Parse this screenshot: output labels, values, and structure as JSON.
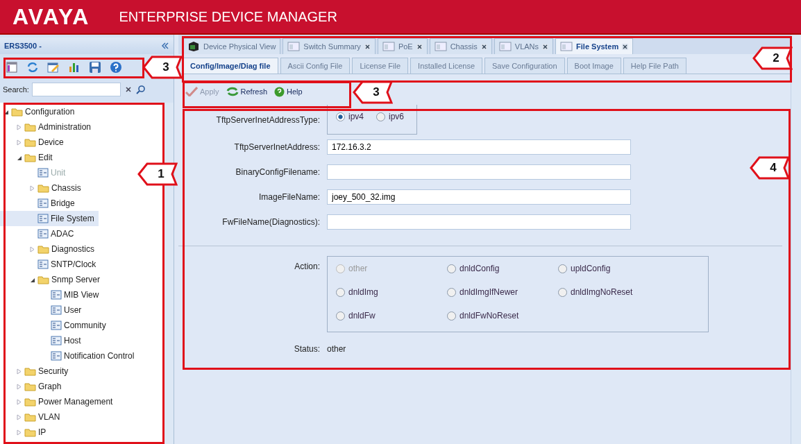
{
  "header": {
    "logo": "AVAYA",
    "title": "ENTERPRISE DEVICE MANAGER"
  },
  "sidebar": {
    "title": "ERS3500 -",
    "search": {
      "label": "Search:"
    },
    "tree": [
      {
        "label": "Configuration",
        "kind": "folder",
        "expanded": true,
        "selected": false,
        "disabled": false,
        "children": [
          {
            "label": "Administration",
            "kind": "folder",
            "expanded": false,
            "selected": false,
            "disabled": false
          },
          {
            "label": "Device",
            "kind": "folder",
            "expanded": false,
            "selected": false,
            "disabled": false
          },
          {
            "label": "Edit",
            "kind": "folder",
            "expanded": true,
            "selected": false,
            "disabled": false,
            "children": [
              {
                "label": "Unit",
                "kind": "leaf",
                "selected": false,
                "disabled": true
              },
              {
                "label": "Chassis",
                "kind": "folder",
                "expanded": false,
                "selected": false,
                "disabled": false
              },
              {
                "label": "Bridge",
                "kind": "leaf",
                "selected": false,
                "disabled": false
              },
              {
                "label": "File System",
                "kind": "leaf",
                "selected": true,
                "disabled": false
              },
              {
                "label": "ADAC",
                "kind": "leaf",
                "selected": false,
                "disabled": false
              },
              {
                "label": "Diagnostics",
                "kind": "folder",
                "expanded": false,
                "selected": false,
                "disabled": false
              },
              {
                "label": "SNTP/Clock",
                "kind": "leaf",
                "selected": false,
                "disabled": false
              },
              {
                "label": "Snmp Server",
                "kind": "folder",
                "expanded": true,
                "selected": false,
                "disabled": false,
                "children": [
                  {
                    "label": "MIB View",
                    "kind": "leaf",
                    "selected": false,
                    "disabled": false
                  },
                  {
                    "label": "User",
                    "kind": "leaf",
                    "selected": false,
                    "disabled": false
                  },
                  {
                    "label": "Community",
                    "kind": "leaf",
                    "selected": false,
                    "disabled": false
                  },
                  {
                    "label": "Host",
                    "kind": "leaf",
                    "selected": false,
                    "disabled": false
                  },
                  {
                    "label": "Notification Control",
                    "kind": "leaf",
                    "selected": false,
                    "disabled": false
                  }
                ]
              }
            ]
          },
          {
            "label": "Security",
            "kind": "folder",
            "expanded": false,
            "selected": false,
            "disabled": false
          },
          {
            "label": "Graph",
            "kind": "folder",
            "expanded": false,
            "selected": false,
            "disabled": false
          },
          {
            "label": "Power Management",
            "kind": "folder",
            "expanded": false,
            "selected": false,
            "disabled": false
          },
          {
            "label": "VLAN",
            "kind": "folder",
            "expanded": false,
            "selected": false,
            "disabled": false
          },
          {
            "label": "IP",
            "kind": "folder",
            "expanded": false,
            "selected": false,
            "disabled": false
          }
        ]
      }
    ]
  },
  "tabs": [
    {
      "label": "Device Physical View",
      "kind": "device",
      "closable": false,
      "selected": false
    },
    {
      "label": "Switch Summary",
      "kind": "window",
      "closable": true,
      "selected": false
    },
    {
      "label": "PoE",
      "kind": "window",
      "closable": true,
      "selected": false
    },
    {
      "label": "Chassis",
      "kind": "window",
      "closable": true,
      "selected": false
    },
    {
      "label": "VLANs",
      "kind": "window",
      "closable": true,
      "selected": false
    },
    {
      "label": "File System",
      "kind": "window",
      "closable": true,
      "selected": true
    }
  ],
  "subtabs": [
    {
      "label": "Config/Image/Diag file",
      "selected": true
    },
    {
      "label": "Ascii Config File",
      "selected": false
    },
    {
      "label": "License File",
      "selected": false
    },
    {
      "label": "Installed License",
      "selected": false
    },
    {
      "label": "Save Configuration",
      "selected": false
    },
    {
      "label": "Boot Image",
      "selected": false
    },
    {
      "label": "Help File Path",
      "selected": false
    }
  ],
  "toolbar": [
    {
      "label": "Apply",
      "kind": "apply",
      "disabled": true
    },
    {
      "label": "Refresh",
      "kind": "refresh",
      "disabled": false
    },
    {
      "label": "Help",
      "kind": "help",
      "disabled": false
    }
  ],
  "form": {
    "address_type": {
      "label": "TftpServerInetAddressType:",
      "options": [
        {
          "label": "ipv4",
          "selected": true
        },
        {
          "label": "ipv6",
          "selected": false
        }
      ]
    },
    "fields": [
      {
        "label": "TftpServerInetAddress:",
        "value": "172.16.3.2"
      },
      {
        "label": "BinaryConfigFilename:"
      },
      {
        "label": "ImageFileName:",
        "value": "joey_500_32.img"
      },
      {
        "label": "FwFileName(Diagnostics):"
      }
    ],
    "action": {
      "label": "Action:",
      "options": [
        {
          "label": "other",
          "selected": false,
          "disabled": true
        },
        {
          "label": "dnldConfig",
          "selected": false,
          "disabled": false
        },
        {
          "label": "upldConfig",
          "selected": false,
          "disabled": false
        },
        {
          "label": "dnldImg",
          "selected": false,
          "disabled": false
        },
        {
          "label": "dnldImgIfNewer",
          "selected": false,
          "disabled": false
        },
        {
          "label": "dnldImgNoReset",
          "selected": false,
          "disabled": false
        },
        {
          "label": "dnldFw",
          "selected": false,
          "disabled": false
        },
        {
          "label": "dnldFwNoReset",
          "selected": false,
          "disabled": false
        }
      ]
    },
    "status": {
      "label": "Status:",
      "value": "other"
    }
  },
  "callouts": [
    {
      "label": "2"
    },
    {
      "label": "3"
    },
    {
      "label": "3"
    },
    {
      "label": "1"
    },
    {
      "label": "4"
    }
  ]
}
